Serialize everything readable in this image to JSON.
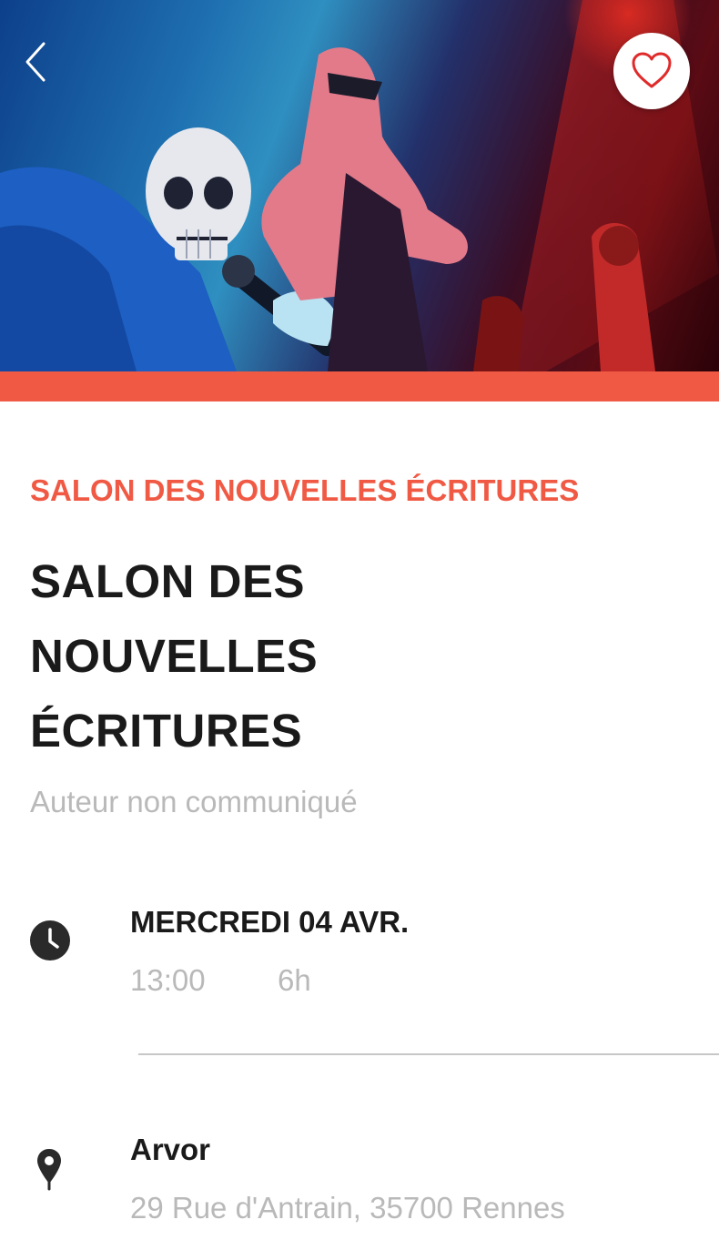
{
  "hero": {
    "image_alt": "Illustration of a skeleton singing into a microphone with rock musicians on stage"
  },
  "header": {
    "back_icon": "chevron-left-icon",
    "favorite_icon": "heart-outline-icon"
  },
  "event": {
    "category": "SALON DES NOUVELLES ÉCRITURES",
    "title_lines": [
      "SALON DES",
      "NOUVELLES",
      "ÉCRITURES"
    ],
    "author": "Auteur non communiqué"
  },
  "schedule": {
    "icon": "clock-icon",
    "date": "MERCREDI 04 AVR.",
    "time": "13:00",
    "duration": "6h"
  },
  "location": {
    "icon": "map-pin-icon",
    "venue": "Arvor",
    "address": "29 Rue d'Antrain, 35700 Rennes"
  },
  "colors": {
    "accent": "#f05a45",
    "text_primary": "#1a1a1a",
    "text_secondary": "#b9b9b9"
  }
}
